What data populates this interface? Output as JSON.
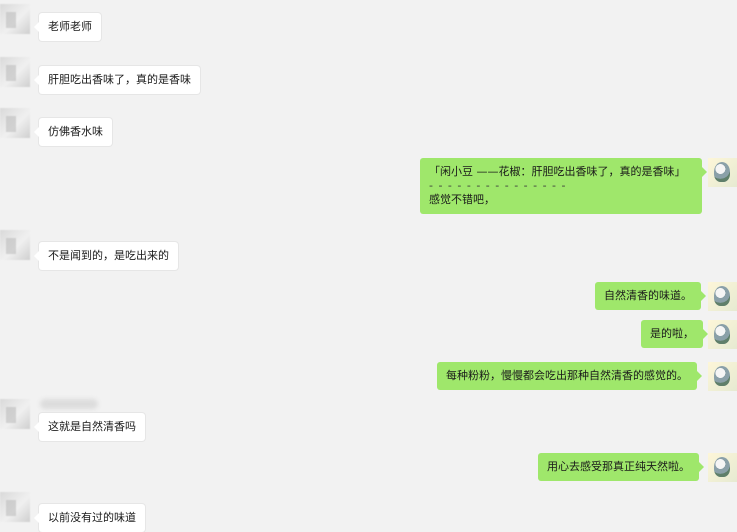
{
  "messages": {
    "m1": "老师老师",
    "m2": "肝胆吃出香味了，真的是香味",
    "m3": "仿佛香水味",
    "m4_quote": "「闲小豆 ——花椒：肝胆吃出香味了，真的是香味」",
    "m4_dashes": "- - - - - - - - - - - - - - -",
    "m4_reply": "感觉不错吧，",
    "m5": "不是闻到的，是吃出来的",
    "m6": "自然清香的味道。",
    "m7": "是的啦，",
    "m8": "每种粉粉，慢慢都会吃出那种自然清香的感觉的。",
    "m9": "这就是自然清香吗",
    "m10": "用心去感受那真正纯天然啦。",
    "m11": "以前没有过的味道"
  },
  "colors": {
    "background": "#f2f2f2",
    "incoming_bubble": "#ffffff",
    "outgoing_bubble": "#9fe76b"
  },
  "icons": {
    "incoming_avatar": "blurred-avatar",
    "outgoing_avatar": "user-avatar"
  }
}
